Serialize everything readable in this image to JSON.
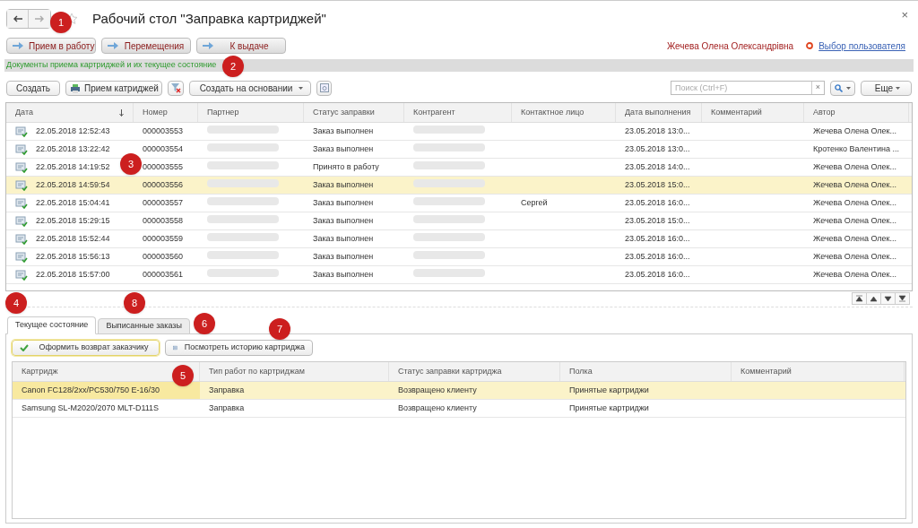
{
  "window": {
    "title": "Рабочий стол \"Заправка картриджей\"",
    "close": "×"
  },
  "nav_buttons": [
    {
      "label": "Прием в работу"
    },
    {
      "label": "Перемещения"
    },
    {
      "label": "К выдаче"
    }
  ],
  "user": {
    "name": "Жечева Олена Олександрівна",
    "link": "Выбор пользователя"
  },
  "section_title": "Документы приема картриджей и их текущее состояние",
  "toolbar": {
    "create": "Создать",
    "receive": "Прием катриджей",
    "create_based": "Создать на основании",
    "search_placeholder": "Поиск (Ctrl+F)",
    "search_clear": "×",
    "more": "Еще"
  },
  "documents": {
    "columns": [
      {
        "label": "Дата",
        "sorted": true
      },
      {
        "label": "Номер",
        "sorted": false
      },
      {
        "label": "Партнер",
        "sorted": false
      },
      {
        "label": "Статус заправки",
        "sorted": false
      },
      {
        "label": "Контрагент",
        "sorted": false
      },
      {
        "label": "Контактное лицо",
        "sorted": false
      },
      {
        "label": "Дата выполнения",
        "sorted": false
      },
      {
        "label": "Комментарий",
        "sorted": false
      },
      {
        "label": "Автор",
        "sorted": false
      }
    ],
    "rows": [
      {
        "date": "22.05.2018 12:52:43",
        "number": "000003553",
        "status": "Заказ выполнен",
        "contact": "",
        "due": "23.05.2018 13:0...",
        "author": "Жечева Олена Олек...",
        "selected": false
      },
      {
        "date": "22.05.2018 13:22:42",
        "number": "000003554",
        "status": "Заказ выполнен",
        "contact": "",
        "due": "23.05.2018 13:0...",
        "author": "Кротенко Валентина ...",
        "selected": false
      },
      {
        "date": "22.05.2018 14:19:52",
        "number": "000003555",
        "status": "Принято в работу",
        "contact": "",
        "due": "23.05.2018 14:0...",
        "author": "Жечева Олена Олек...",
        "selected": false
      },
      {
        "date": "22.05.2018 14:59:54",
        "number": "000003556",
        "status": "Заказ выполнен",
        "contact": "",
        "due": "23.05.2018 15:0...",
        "author": "Жечева Олена Олек...",
        "selected": true
      },
      {
        "date": "22.05.2018 15:04:41",
        "number": "000003557",
        "status": "Заказ выполнен",
        "contact": "Сергей",
        "due": "23.05.2018 16:0...",
        "author": "Жечева Олена Олек...",
        "selected": false
      },
      {
        "date": "22.05.2018 15:29:15",
        "number": "000003558",
        "status": "Заказ выполнен",
        "contact": "",
        "due": "23.05.2018 15:0...",
        "author": "Жечева Олена Олек...",
        "selected": false
      },
      {
        "date": "22.05.2018 15:52:44",
        "number": "000003559",
        "status": "Заказ выполнен",
        "contact": "",
        "due": "23.05.2018 16:0...",
        "author": "Жечева Олена Олек...",
        "selected": false
      },
      {
        "date": "22.05.2018 15:56:13",
        "number": "000003560",
        "status": "Заказ выполнен",
        "contact": "",
        "due": "23.05.2018 16:0...",
        "author": "Жечева Олена Олек...",
        "selected": false
      },
      {
        "date": "22.05.2018 15:57:00",
        "number": "000003561",
        "status": "Заказ выполнен",
        "contact": "",
        "due": "23.05.2018 16:0...",
        "author": "Жечева Олена Олек...",
        "selected": false
      }
    ]
  },
  "tabs": [
    {
      "label": "Текущее состояние",
      "selected": true
    },
    {
      "label": "Выписанные заказы",
      "selected": false
    }
  ],
  "panel_buttons": [
    {
      "label": "Оформить возврат заказчику",
      "kind": "check",
      "selected": true
    },
    {
      "label": "Посмотреть историю картриджа",
      "kind": "list",
      "selected": false
    }
  ],
  "cartridges": {
    "columns": [
      "Картридж",
      "Тип работ по картриджам",
      "Статус заправки картриджа",
      "Полка",
      "Комментарий"
    ],
    "rows": [
      {
        "cells": [
          "Canon FC128/2xx/PC530/750 E-16/30",
          "Заправка",
          "Возвращено клиенту",
          "Принятые картриджи",
          ""
        ],
        "selected": true
      },
      {
        "cells": [
          "Samsung SL-M2020/2070 MLT-D111S",
          "Заправка",
          "Возвращено клиенту",
          "Принятые картриджи",
          ""
        ],
        "selected": false
      }
    ]
  },
  "annotations": [
    {
      "label": "1"
    },
    {
      "label": "2"
    },
    {
      "label": "3"
    },
    {
      "label": "4"
    },
    {
      "label": "5"
    },
    {
      "label": "6"
    },
    {
      "label": "7"
    },
    {
      "label": "8"
    }
  ]
}
